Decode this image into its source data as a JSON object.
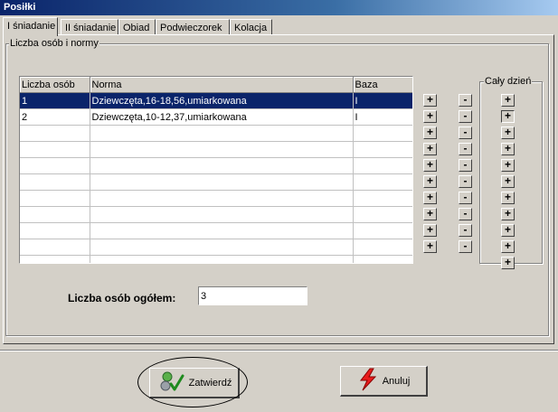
{
  "window": {
    "title": "Posiłki"
  },
  "tabs": [
    {
      "label": "I śniadanie",
      "active": true
    },
    {
      "label": "II śniadanie"
    },
    {
      "label": "Obiad"
    },
    {
      "label": "Podwieczorek"
    },
    {
      "label": "Kolacja"
    }
  ],
  "group": {
    "title": "Liczba osób i normy"
  },
  "grid": {
    "columns": [
      "Liczba osób",
      "Norma",
      "Baza"
    ],
    "rows": [
      {
        "count": "1",
        "norm": "Dziewczęta,16-18,56,umiarkowana",
        "base": "I",
        "selected": true
      },
      {
        "count": "2",
        "norm": "Dziewczęta,10-12,37,umiarkowana",
        "base": "I"
      },
      {
        "count": "",
        "norm": "",
        "base": ""
      },
      {
        "count": "",
        "norm": "",
        "base": ""
      },
      {
        "count": "",
        "norm": "",
        "base": ""
      },
      {
        "count": "",
        "norm": "",
        "base": ""
      },
      {
        "count": "",
        "norm": "",
        "base": ""
      },
      {
        "count": "",
        "norm": "",
        "base": ""
      },
      {
        "count": "",
        "norm": "",
        "base": ""
      },
      {
        "count": "",
        "norm": "",
        "base": ""
      },
      {
        "count": "",
        "norm": "",
        "base": ""
      }
    ]
  },
  "row_buttons": {
    "plus": "+",
    "minus": "-",
    "count": 10
  },
  "whole_day": {
    "title": "Cały dzień",
    "symbol": "+",
    "count": 11,
    "pressed_index": 1
  },
  "total": {
    "label": "Liczba osób ogółem:",
    "value": "3"
  },
  "buttons": {
    "ok": "Zatwierdź",
    "cancel": "Anuluj"
  },
  "colors": {
    "selection": "#0a246a",
    "title_bar": "#0a246a",
    "face": "#d4d0c8"
  }
}
